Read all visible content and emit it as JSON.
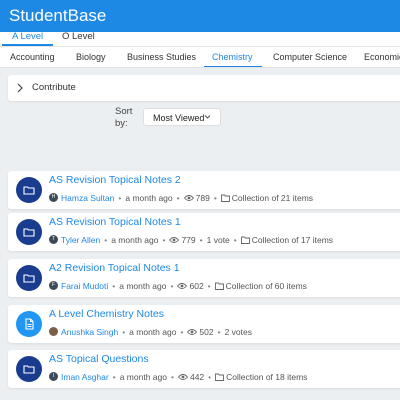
{
  "app": {
    "title": "StudentBase"
  },
  "levels": [
    {
      "label": "A Level",
      "active": true
    },
    {
      "label": "O Level",
      "active": false
    }
  ],
  "subjects": [
    {
      "label": "Accounting",
      "active": false
    },
    {
      "label": "Biology",
      "active": false
    },
    {
      "label": "Business Studies",
      "active": false
    },
    {
      "label": "Chemistry",
      "active": true
    },
    {
      "label": "Computer Science",
      "active": false
    },
    {
      "label": "Economic",
      "active": false
    }
  ],
  "contribute": {
    "label": "Contribute",
    "icon": "chevron-right-icon"
  },
  "sort": {
    "label": "Sort by:",
    "value": "Most Viewed",
    "icon": "chevron-down-icon"
  },
  "colors": {
    "primary": "#1e88e5",
    "folder_icon_bg": "#1a3c8f",
    "doc_icon_bg": "#2196f3",
    "background": "#eceff1"
  },
  "notes": [
    {
      "title": "AS Revision Topical Notes 2",
      "icon": "folder-icon",
      "avatar": "H",
      "author": "Hamza Sultan",
      "time": "a month ago",
      "views": "789",
      "votes": "",
      "collection": "Collection of 21 items"
    },
    {
      "title": "AS Revision Topical Notes 1",
      "icon": "folder-icon",
      "avatar": "T",
      "author": "Tyler Allen",
      "time": "a month ago",
      "views": "779",
      "votes": "1 vote",
      "collection": "Collection of 17 items"
    },
    {
      "title": "A2 Revision Topical Notes 1",
      "icon": "folder-icon",
      "avatar": "F",
      "author": "Farai Mudoti",
      "time": "a month ago",
      "views": "602",
      "votes": "",
      "collection": "Collection of 60 items"
    },
    {
      "title": "A Level Chemistry Notes",
      "icon": "document-icon",
      "avatar": "",
      "author": "Anushka Singh",
      "time": "a month ago",
      "views": "502",
      "votes": "2 votes",
      "collection": ""
    },
    {
      "title": "AS Topical Questions",
      "icon": "folder-icon",
      "avatar": "I",
      "author": "Iman Asghar",
      "time": "a month ago",
      "views": "442",
      "votes": "",
      "collection": "Collection of 18 items"
    }
  ]
}
